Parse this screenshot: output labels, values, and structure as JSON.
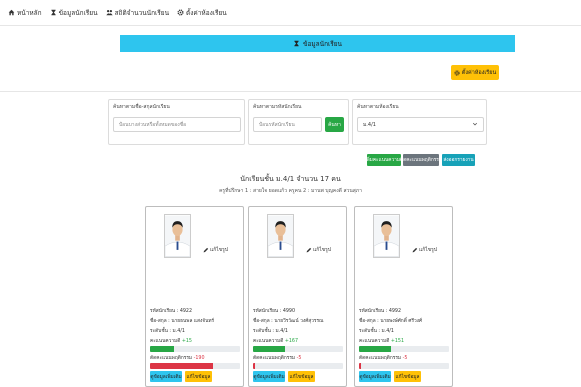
{
  "nav": {
    "items": [
      {
        "label": "หน้าหลัก",
        "icon": "home-icon"
      },
      {
        "label": "ข้อมูลนักเรียน",
        "icon": "hourglass-icon"
      },
      {
        "label": "สถิติจำนวนนักเรียน",
        "icon": "users-icon"
      },
      {
        "label": "ตั้งค่าห้องเรียน",
        "icon": "gear-icon"
      }
    ]
  },
  "header": {
    "title": "ข้อมูลนักเรียน",
    "icon": "hourglass-icon"
  },
  "settings_button": {
    "label": "ตั้งค่าห้องเรียน",
    "icon": "gear-icon"
  },
  "filters": {
    "search_all": {
      "label": "ค้นหาตามชื่อ-สกุลนักเรียน",
      "placeholder": "ป้อนบางส่วนหรือทั้งหมดของชื่อ"
    },
    "search_id": {
      "label": "ค้นหาตามรหัสนักเรียน",
      "placeholder": "ป้อนรหัสนักเรียน",
      "button": "ค้นหา"
    },
    "room": {
      "label": "ค้นหาตามห้องเรียน",
      "selected": "ม.4/1"
    }
  },
  "actions": {
    "good": "เพิ่มคะแนนความดี",
    "behavior": "ตัดคะแนนพฤติกรรม",
    "export": "ส่งออกรายงาน"
  },
  "colors": {
    "accent": "#2ec5ee",
    "warning": "#ffc107",
    "success": "#28a745",
    "danger": "#dc3545",
    "secondary": "#6c757d",
    "info": "#17a2b8"
  },
  "summary": {
    "main": "นักเรียนชั้น ม.4/1 จำนวน 17 คน",
    "advisors": "ครูที่ปรึกษา 1 : สายใจ ยอดแก้ว  ครูคน 2 : มานพ บุญคงดี สวนสุภา"
  },
  "card_labels": {
    "edit_photo": "แก้ไขรูป",
    "id": "รหัสนักเรียน",
    "name": "ชื่อ-สกุล",
    "class": "ระดับชั้น",
    "good": "คะแนนความดี",
    "behavior": "ตัดคะแนนพฤติกรรม",
    "details": "ดูข้อมูลเพิ่มเติม",
    "edit": "แก้ไขข้อมูล"
  },
  "students": [
    {
      "id": ": 4922",
      "name": ": นายธนพล แสงจันทร์",
      "class": ": ม.4/1",
      "good": "+15",
      "good_pct": 0.27,
      "behavior": "-190",
      "behavior_pct": 0.7
    },
    {
      "id": ": 4990",
      "name": ": นายวีรวัฒน์ วงศ์สุวรรณ",
      "class": ": ม.4/1",
      "good": "+167",
      "good_pct": 0.36,
      "behavior": "-5",
      "behavior_pct": 0.02
    },
    {
      "id": ": 4992",
      "name": ": นายพงษ์ศักดิ์ ศรีวงศ์",
      "class": ": ม.4/1",
      "good": "+151",
      "good_pct": 0.36,
      "behavior": "-5",
      "behavior_pct": 0.02
    }
  ]
}
